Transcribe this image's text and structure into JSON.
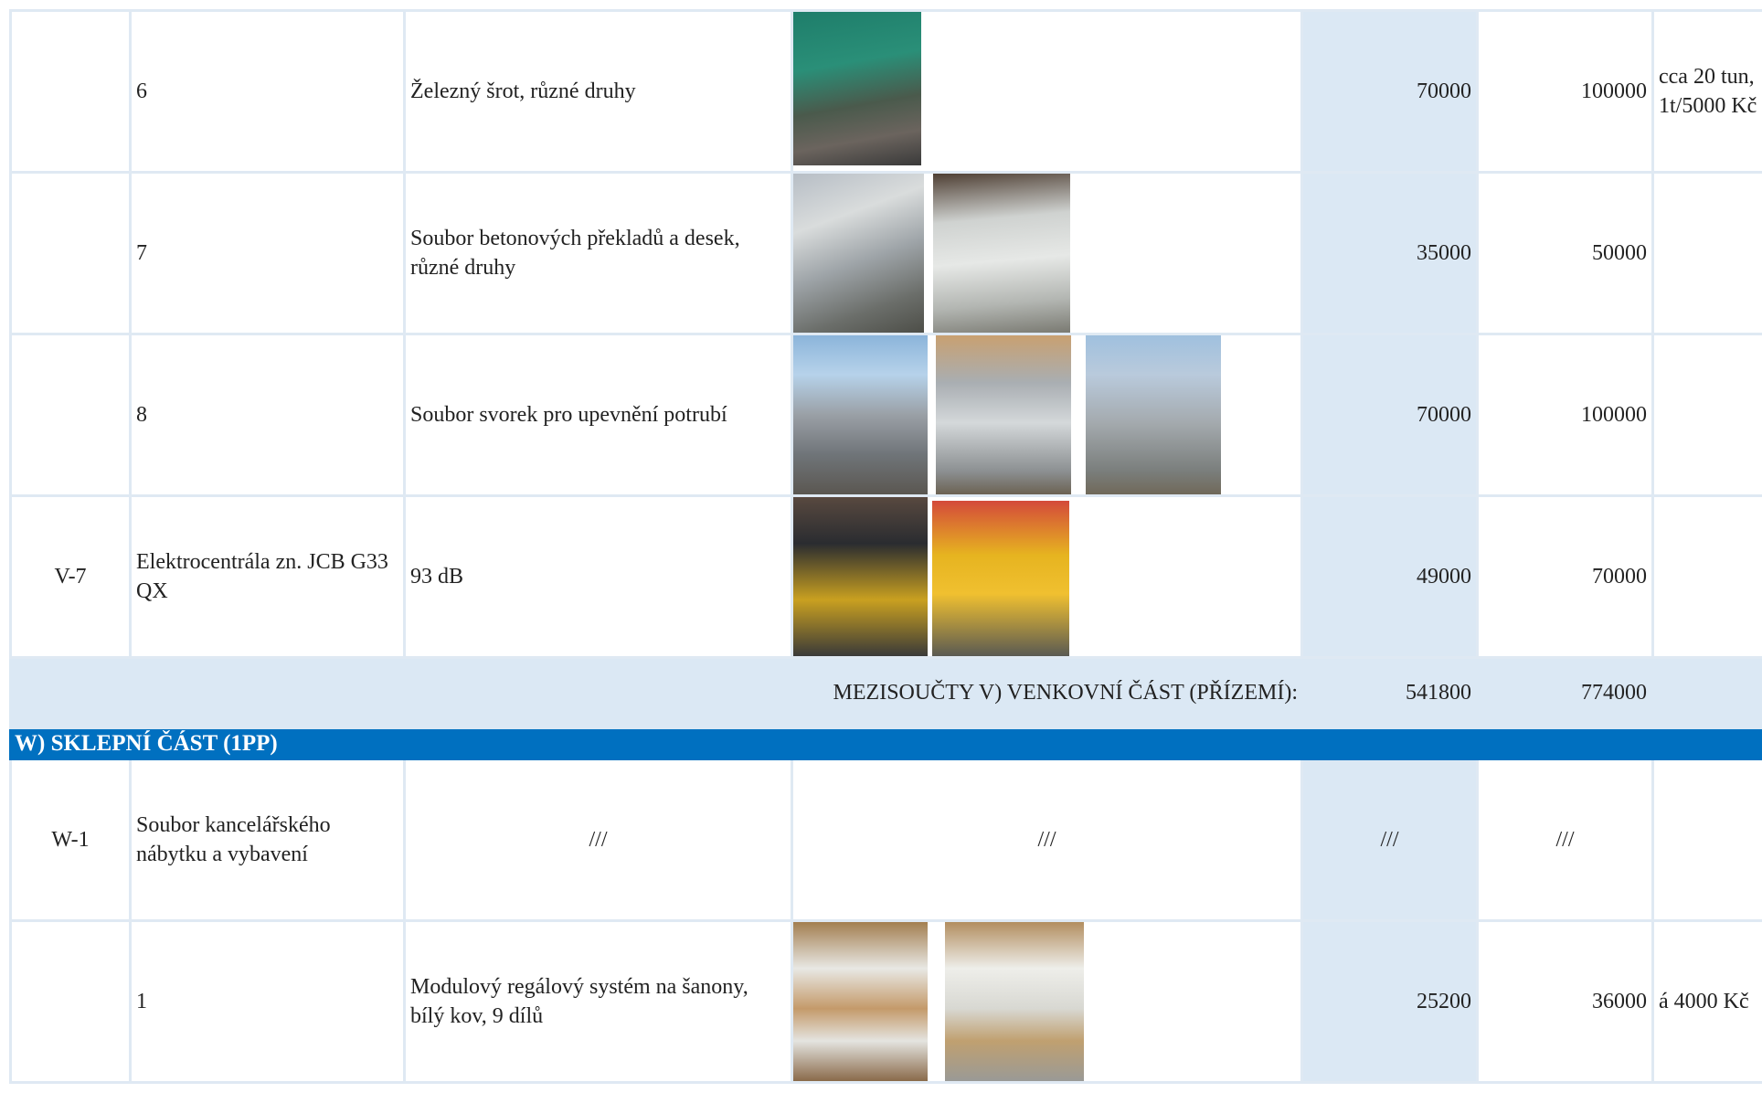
{
  "rows": [
    {
      "id": "",
      "name": "",
      "number": "6",
      "description": "Železný šrot, různé druhy",
      "photos": [
        "scrap-metal-photo"
      ],
      "value_low": "70000",
      "value_high": "100000",
      "note": "cca 20 tun, 1t/5000 Kč"
    },
    {
      "id": "",
      "name": "",
      "number": "7",
      "description": "Soubor betonových překladů a desek, různé druhy",
      "photos": [
        "concrete-lintels-photo",
        "concrete-slabs-photo"
      ],
      "value_low": "35000",
      "value_high": "50000",
      "note": ""
    },
    {
      "id": "",
      "name": "",
      "number": "8",
      "description": "Soubor svorek pro upevnění potrubí",
      "photos": [
        "pipe-clamps-photo-1",
        "pipe-clamps-photo-2",
        "pipe-clamps-photo-3"
      ],
      "value_low": "70000",
      "value_high": "100000",
      "note": ""
    },
    {
      "id": "V-7",
      "name": "Elektrocentrála zn. JCB G33 QX",
      "number": "",
      "description": "93 dB",
      "photos": [
        "generator-photo-1",
        "generator-photo-2"
      ],
      "value_low": "49000",
      "value_high": "70000",
      "note": ""
    }
  ],
  "subtotal": {
    "label": "MEZISOUČTY V) VENKOVNÍ ČÁST (PŘÍZEMÍ):",
    "value_low": "541800",
    "value_high": "774000"
  },
  "section": {
    "title": "W) SKLEPNÍ ČÁST (1PP)"
  },
  "w1": {
    "id": "W-1",
    "name": "Soubor kancelářského nábytku a vybavení",
    "placeholder": "///"
  },
  "w_row1": {
    "number": "1",
    "description": "Modulový regálový systém na šanony, bílý kov, 9 dílů",
    "photos": [
      "shelving-photo-1",
      "shelving-photo-2"
    ],
    "value_low": "25200",
    "value_high": "36000",
    "note": "á 4000 Kč"
  }
}
